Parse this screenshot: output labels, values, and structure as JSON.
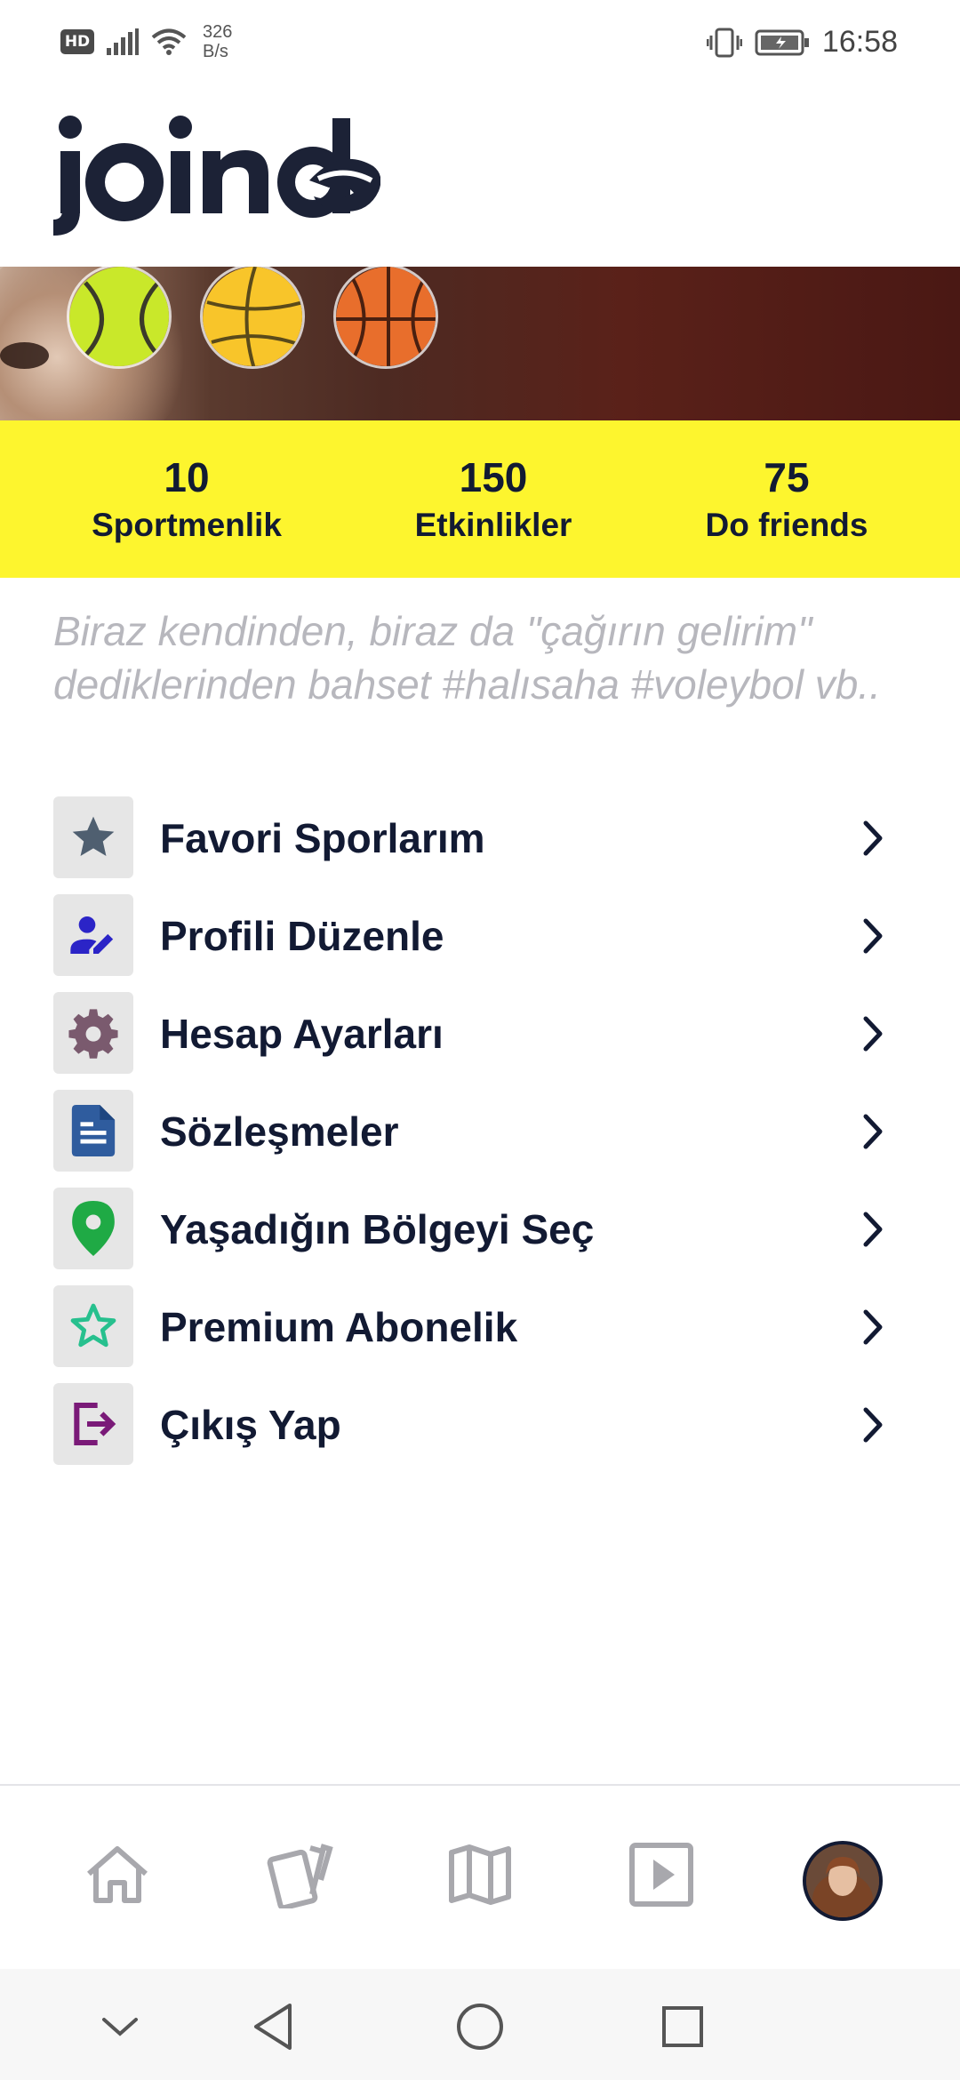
{
  "status_bar": {
    "hd_badge": "HD",
    "net_speed_value": "326",
    "net_speed_unit": "B/s",
    "time": "16:58"
  },
  "header": {
    "logo_text": "join do"
  },
  "stats": [
    {
      "value": "10",
      "label": "Sportmenlik"
    },
    {
      "value": "150",
      "label": "Etkinlikler"
    },
    {
      "value": "75",
      "label": "Do friends"
    }
  ],
  "bio": {
    "placeholder": "Biraz kendinden, biraz da \"çağırın gelirim\" dediklerinden bahset #halısaha #voleybol vb.."
  },
  "menu": {
    "items": [
      {
        "label": "Favori Sporlarım",
        "icon": "star-icon",
        "color": "#4f5f70"
      },
      {
        "label": "Profili Düzenle",
        "icon": "edit-user-icon",
        "color": "#2b24c7"
      },
      {
        "label": "Hesap Ayarları",
        "icon": "gear-icon",
        "color": "#7a5a6e"
      },
      {
        "label": "Sözleşmeler",
        "icon": "document-icon",
        "color": "#2f5c9e"
      },
      {
        "label": "Yaşadığın Bölgeyi Seç",
        "icon": "location-pin-icon",
        "color": "#1faa45"
      },
      {
        "label": "Premium Abonelik",
        "icon": "star-outline-icon",
        "color": "#27c08e"
      },
      {
        "label": "Çıkış Yap",
        "icon": "logout-icon",
        "color": "#7a1a78"
      }
    ]
  },
  "bottom_nav": {
    "items": [
      "home-icon",
      "cards-icon",
      "map-icon",
      "play-icon",
      "profile-avatar"
    ]
  },
  "colors": {
    "stats_bg": "#fdf52e",
    "text_dark": "#121a33",
    "placeholder": "#b7b7bd",
    "icon_box": "#e6e6e6"
  }
}
